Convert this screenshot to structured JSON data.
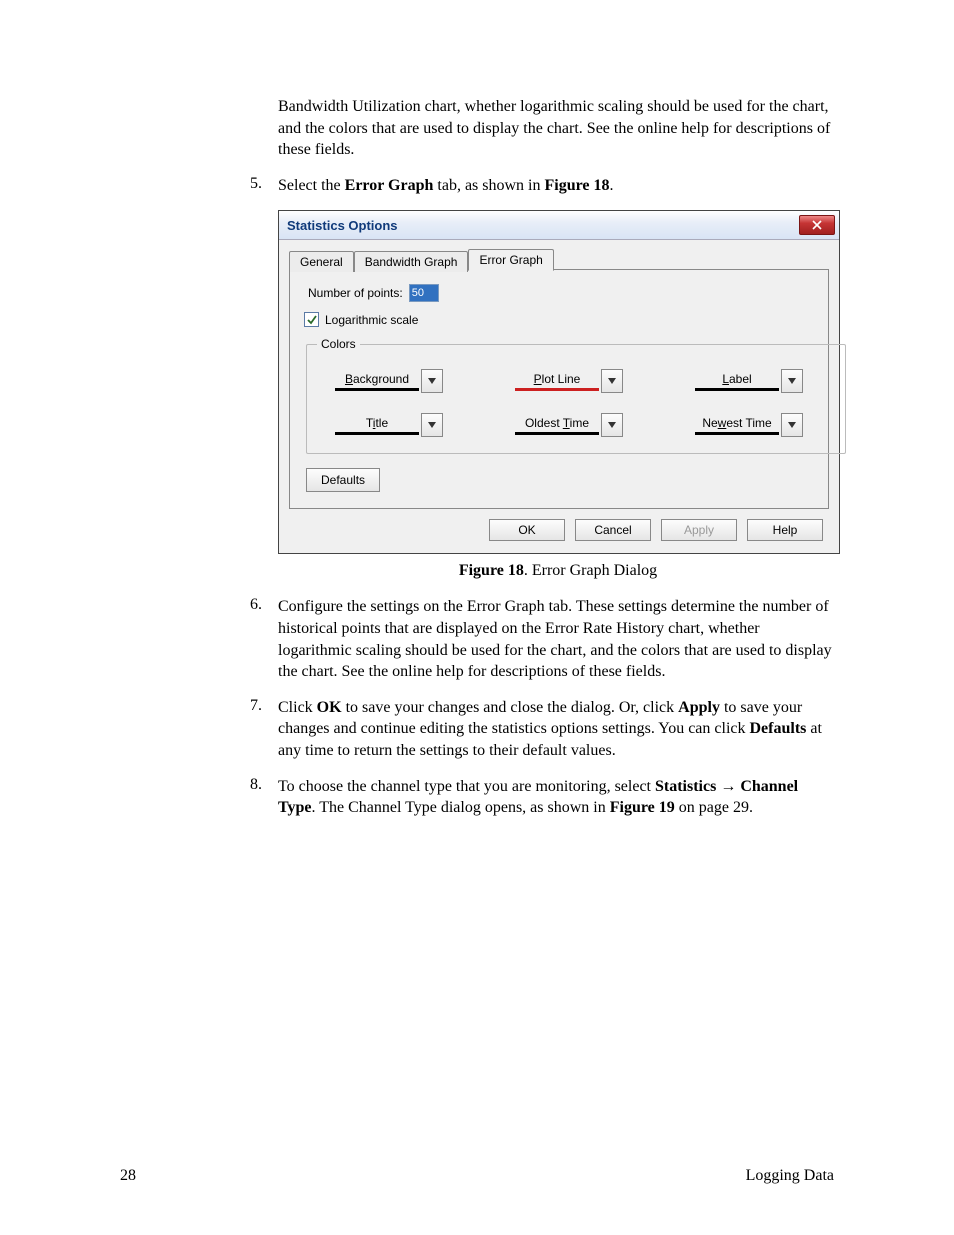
{
  "intro_paragraph": "Bandwidth Utilization chart, whether logarithmic scaling should be used for the chart, and the colors that are used to display the chart.  See the online help for descriptions of these fields.",
  "step5": {
    "num": "5.",
    "pre": "Select the ",
    "bold1": "Error Graph",
    "mid": " tab, as shown in ",
    "bold2": "Figure 18",
    "post": "."
  },
  "dialog": {
    "title": "Statistics Options",
    "tabs": {
      "general": "General",
      "bandwidth": "Bandwidth Graph",
      "error": "Error Graph"
    },
    "num_points_label": "Number of points:",
    "num_points_value": "50",
    "log_scale_label": "Logarithmic scale",
    "colors_legend": "Colors",
    "colors": {
      "background": {
        "pre": "",
        "mn": "B",
        "post": "ackground",
        "swatch": "#000000"
      },
      "plotline": {
        "pre": "",
        "mn": "P",
        "post": "lot Line",
        "swatch": "#cc2020"
      },
      "label": {
        "pre": "",
        "mn": "L",
        "post": "abel",
        "swatch": "#000000"
      },
      "title": {
        "pre": "T",
        "mn": "i",
        "post": "tle",
        "swatch": "#000000"
      },
      "oldest": {
        "pre": "Oldest ",
        "mn": "T",
        "post": "ime",
        "swatch": "#000000"
      },
      "newest": {
        "pre": "Ne",
        "mn": "w",
        "post": "est Time",
        "swatch": "#000000"
      }
    },
    "defaults_label": "Defaults",
    "buttons": {
      "ok": "OK",
      "cancel": "Cancel",
      "apply": "Apply",
      "help": "Help"
    }
  },
  "caption": {
    "bold": "Figure 18",
    "rest": ". Error Graph Dialog"
  },
  "step6": {
    "num": "6.",
    "text": "Configure the settings on the Error Graph tab.  These settings determine the number of historical points that are displayed on the Error Rate History chart, whether logarithmic scaling should be used for the chart, and the colors that are used to display the chart.  See the online help for descriptions of these fields."
  },
  "step7": {
    "num": "7.",
    "a": "Click ",
    "b_ok": "OK",
    "c": " to save your changes and close the dialog.  Or, click ",
    "b_apply": "Apply",
    "d": " to save your changes and continue editing the statistics options settings.  You can click ",
    "b_defaults": "Defaults",
    "e": " at any time to return the settings to their default values."
  },
  "step8": {
    "num": "8.",
    "a": "To choose the channel type that you are monitoring, select ",
    "b_stats": "Statistics",
    "arrow": " → ",
    "b_chtype": "Channel Type",
    "c": ".  The Channel Type dialog opens, as shown in ",
    "b_fig": "Figure 19",
    "d": " on page 29."
  },
  "footer": {
    "page": "28",
    "section": "Logging Data"
  }
}
